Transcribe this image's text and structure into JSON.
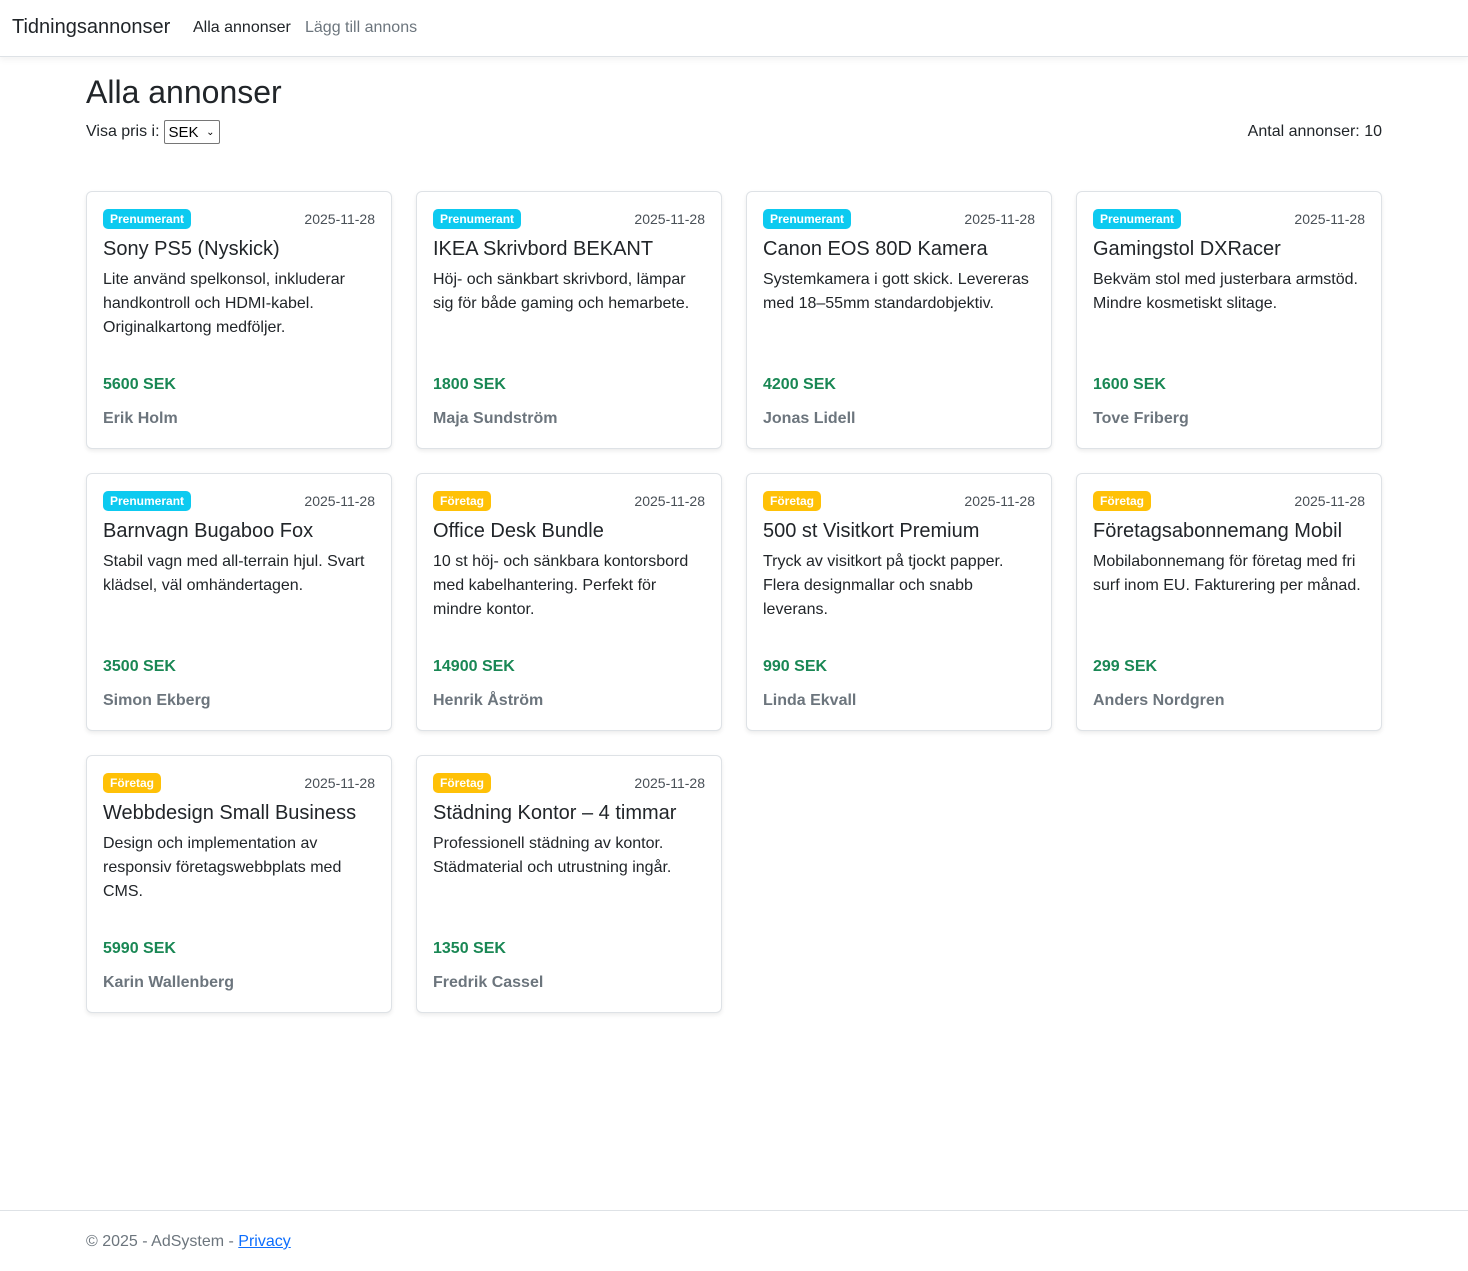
{
  "nav": {
    "brand": "Tidningsannonser",
    "links": [
      {
        "label": "Alla annonser"
      },
      {
        "label": "Lägg till annons"
      }
    ]
  },
  "main": {
    "title": "Alla annonser",
    "currency_label": "Visa pris i:",
    "currency_selected": "SEK",
    "count_label": "Antal annonser: 10"
  },
  "ads": [
    {
      "badge": "Prenumerant",
      "kind": "sub",
      "date": "2025-11-28",
      "title": "Sony PS5 (Nyskick)",
      "desc": "Lite använd spelkonsol, inkluderar handkontroll och HDMI-kabel. Originalkartong medföljer.",
      "price": "5600 SEK",
      "seller": "Erik Holm"
    },
    {
      "badge": "Prenumerant",
      "kind": "sub",
      "date": "2025-11-28",
      "title": "IKEA Skrivbord BEKANT",
      "desc": "Höj- och sänkbart skrivbord, lämpar sig för både gaming och hemarbete.",
      "price": "1800 SEK",
      "seller": "Maja Sundström"
    },
    {
      "badge": "Prenumerant",
      "kind": "sub",
      "date": "2025-11-28",
      "title": "Canon EOS 80D Kamera",
      "desc": "Systemkamera i gott skick. Levereras med 18–55mm standardobjektiv.",
      "price": "4200 SEK",
      "seller": "Jonas Lidell"
    },
    {
      "badge": "Prenumerant",
      "kind": "sub",
      "date": "2025-11-28",
      "title": "Gamingstol DXRacer",
      "desc": "Bekväm stol med justerbara armstöd. Mindre kosmetiskt slitage.",
      "price": "1600 SEK",
      "seller": "Tove Friberg"
    },
    {
      "badge": "Prenumerant",
      "kind": "sub",
      "date": "2025-11-28",
      "title": "Barnvagn Bugaboo Fox",
      "desc": "Stabil vagn med all-terrain hjul. Svart klädsel, väl omhändertagen.",
      "price": "3500 SEK",
      "seller": "Simon Ekberg"
    },
    {
      "badge": "Företag",
      "kind": "corp",
      "date": "2025-11-28",
      "title": "Office Desk Bundle",
      "desc": "10 st höj- och sänkbara kontorsbord med kabelhantering. Perfekt för mindre kontor.",
      "price": "14900 SEK",
      "seller": "Henrik Åström"
    },
    {
      "badge": "Företag",
      "kind": "corp",
      "date": "2025-11-28",
      "title": "500 st Visitkort Premium",
      "desc": "Tryck av visitkort på tjockt papper. Flera designmallar och snabb leverans.",
      "price": "990 SEK",
      "seller": "Linda Ekvall"
    },
    {
      "badge": "Företag",
      "kind": "corp",
      "date": "2025-11-28",
      "title": "Företagsabonnemang Mobil",
      "desc": "Mobilabonnemang för företag med fri surf inom EU. Fakturering per månad.",
      "price": "299 SEK",
      "seller": "Anders Nordgren"
    },
    {
      "badge": "Företag",
      "kind": "corp",
      "date": "2025-11-28",
      "title": "Webbdesign Small Business",
      "desc": "Design och implementation av responsiv företagswebbplats med CMS.",
      "price": "5990 SEK",
      "seller": "Karin Wallenberg"
    },
    {
      "badge": "Företag",
      "kind": "corp",
      "date": "2025-11-28",
      "title": "Städning Kontor – 4 timmar",
      "desc": "Professionell städning av kontor. Städmaterial och utrustning ingår.",
      "price": "1350 SEK",
      "seller": "Fredrik Cassel"
    }
  ],
  "footer": {
    "text": "© 2025 - AdSystem - ",
    "link": "Privacy"
  }
}
